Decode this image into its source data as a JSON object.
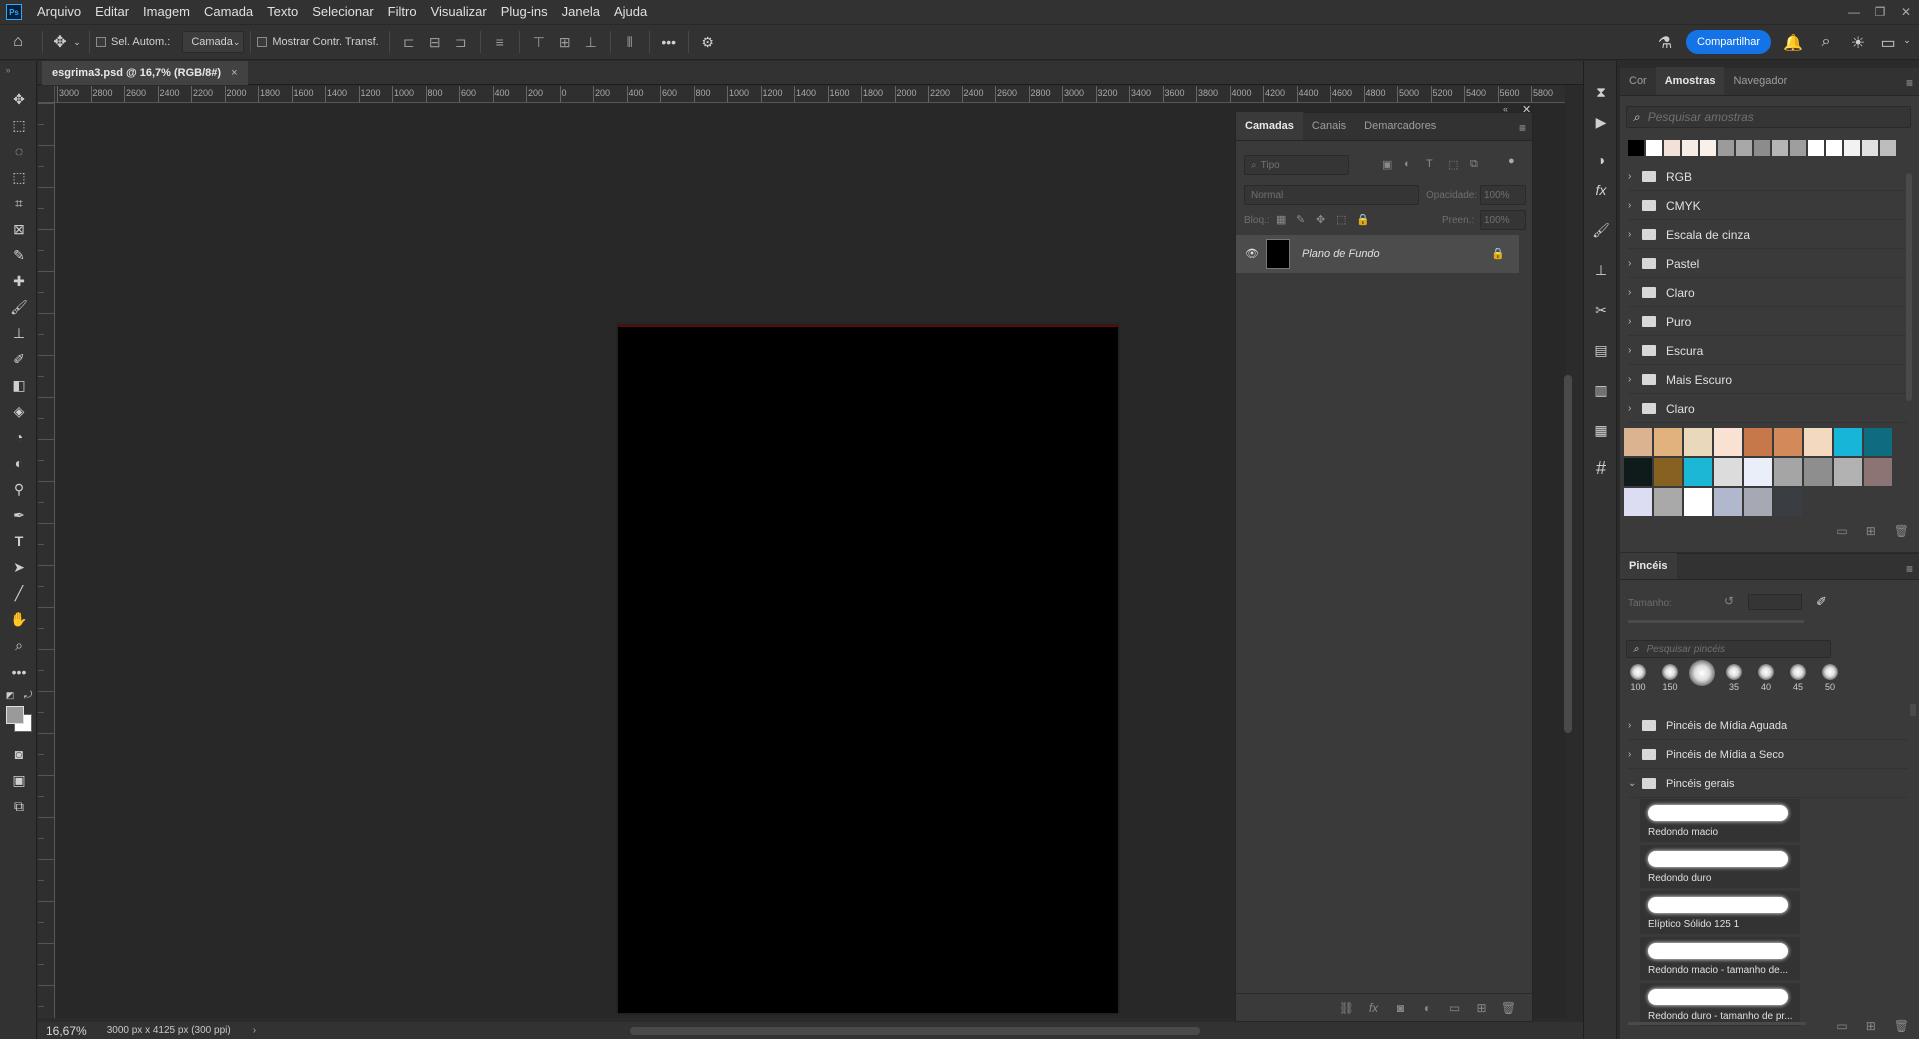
{
  "menubar": {
    "logo": "Ps",
    "items": [
      "Arquivo",
      "Editar",
      "Imagem",
      "Camada",
      "Texto",
      "Selecionar",
      "Filtro",
      "Visualizar",
      "Plug-ins",
      "Janela",
      "Ajuda"
    ]
  },
  "options": {
    "auto_select_label": "Sel. Autom.:",
    "auto_select_target": "Camada",
    "transform_controls_label": "Mostrar Contr. Transf.",
    "share_label": "Compartilhar"
  },
  "document": {
    "tab_title": "esgrima3.psd @ 16,7% (RGB/8#)",
    "tab_close": "×",
    "zoom": "16,67%",
    "doc_size": "3000 px x 4125 px (300 ppi)"
  },
  "ruler": {
    "h_ticks": [
      "3000",
      "2800",
      "2600",
      "2400",
      "2200",
      "2000",
      "1800",
      "1600",
      "1400",
      "1200",
      "1000",
      "800",
      "600",
      "400",
      "200",
      "0",
      "200",
      "400",
      "600",
      "800",
      "1000",
      "1200",
      "1400",
      "1600",
      "1800",
      "2000",
      "2200",
      "2400",
      "2600",
      "2800",
      "3000",
      "3200",
      "3400",
      "3600",
      "3800",
      "4000",
      "4200",
      "4400",
      "4600",
      "4800",
      "5000",
      "5200",
      "5400",
      "5600",
      "5800"
    ]
  },
  "layers_panel": {
    "tabs": [
      "Camadas",
      "Canais",
      "Demarcadores"
    ],
    "filter_placeholder": "Tipo",
    "blend_mode": "Normal",
    "opacity_label": "Opacidade:",
    "opacity_value": "100%",
    "lock_label": "Bloq.:",
    "fill_label": "Preen.:",
    "fill_value": "100%",
    "layers": [
      {
        "name": "Plano de Fundo",
        "visible": true,
        "locked": true
      }
    ]
  },
  "swatches_panel": {
    "tabs": [
      "Cor",
      "Amostras",
      "Navegador"
    ],
    "search_placeholder": "Pesquisar amostras",
    "recent_colors": [
      "#000000",
      "#ffffff",
      "#f2e1d6",
      "#f5ece6",
      "#f9f1e8",
      "#9b9b9b",
      "#a8a8a8",
      "#8c8c8c",
      "#b5b5b5",
      "#9e9e9e",
      "#ffffff",
      "#ffffff",
      "#f2f2f2",
      "#e0e0e0",
      "#bdbdbd"
    ],
    "folders": [
      "RGB",
      "CMYK",
      "Escala de cinza",
      "Pastel",
      "Claro",
      "Puro",
      "Escura",
      "Mais Escuro",
      "Claro"
    ],
    "grid_colors": [
      [
        "#dbb391",
        "#e1b27e",
        "#ead8bd",
        "#f9e2d3",
        "#c7784a",
        "#d28a5a",
        "#f3d9c0",
        "#17b5d7",
        "#0e6b80"
      ],
      [
        "#0f1a1a",
        "#866121",
        "#1db7d6",
        "#dcdcdc",
        "#e9eef8",
        "#a5a5a5",
        "#8e8e8e",
        "#b2b2b2",
        "#8c7474"
      ],
      [
        "#dcdcf2",
        "#a9a9a9",
        "#ffffff",
        "#b1b7cc",
        "#a6a9b3",
        "#3a3d42"
      ]
    ]
  },
  "brushes_panel": {
    "title": "Pincéis",
    "size_label": "Tamanho:",
    "search_placeholder": "Pesquisar pincéis",
    "recent_sizes": [
      "100",
      "150",
      "",
      "35",
      "40",
      "45",
      "50"
    ],
    "folders": [
      "Pincéis de Mídia Aguada",
      "Pincéis de Mídia a Seco",
      "Pincéis gerais"
    ],
    "brushes": [
      "Redondo macio",
      "Redondo duro",
      "Elíptico Sólido 125 1",
      "Redondo macio - tamanho de...",
      "Redondo duro - tamanho de pr..."
    ]
  }
}
